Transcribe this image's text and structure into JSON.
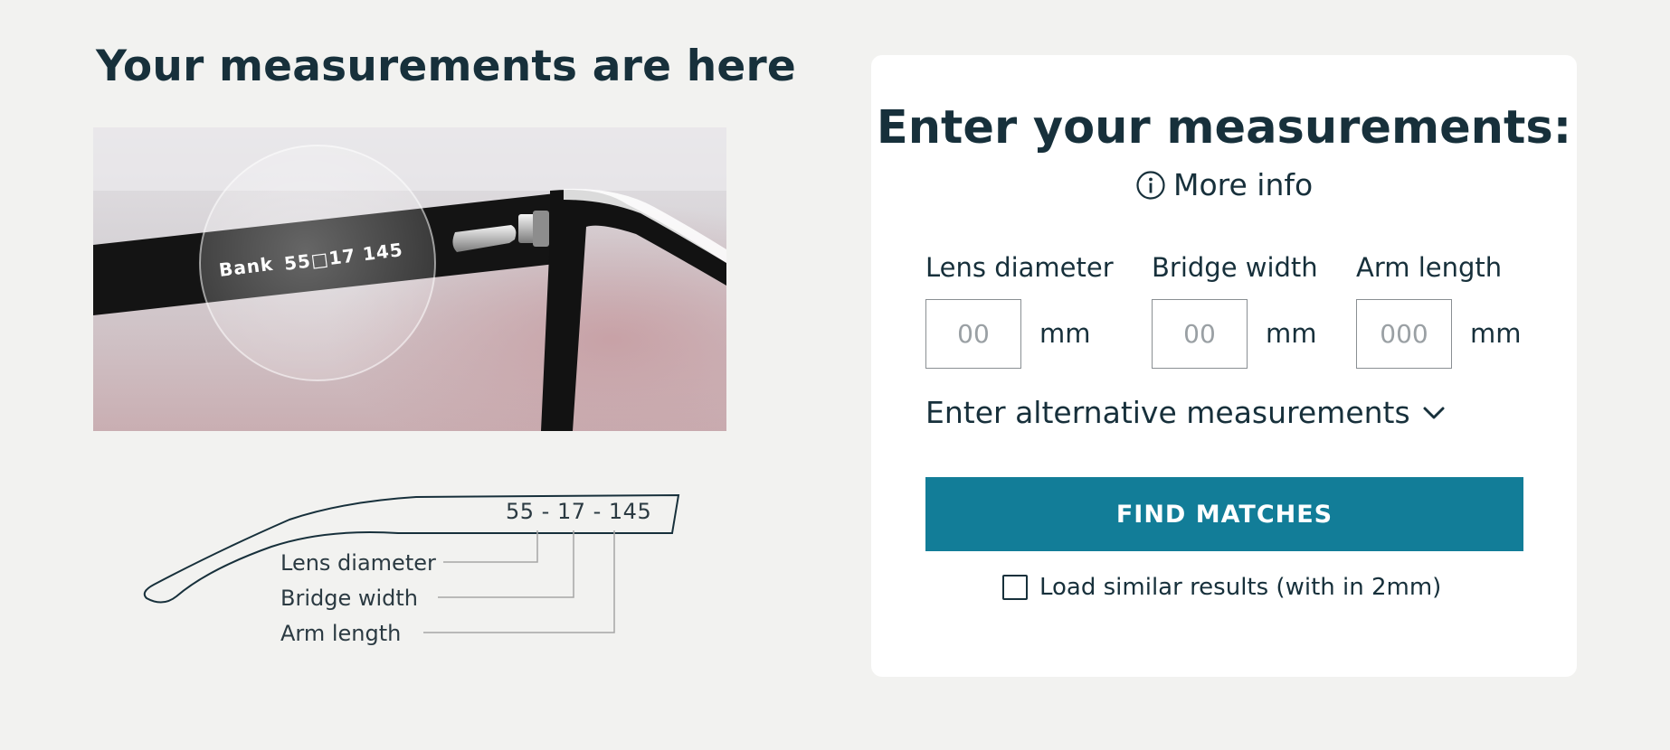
{
  "left": {
    "heading": "Your measurements are here",
    "photo": {
      "temple_print_brand": "Bank",
      "temple_print_code": "55□17 145"
    },
    "diagram": {
      "code": "55 - 17 - 145",
      "labels": {
        "lens": "Lens diameter",
        "bridge": "Bridge width",
        "arm": "Arm length"
      }
    }
  },
  "form": {
    "title": "Enter your measurements:",
    "more_info": "More info",
    "fields": {
      "lens": {
        "label": "Lens diameter",
        "placeholder": "00",
        "value": "",
        "unit": "mm"
      },
      "bridge": {
        "label": "Bridge width",
        "placeholder": "00",
        "value": "",
        "unit": "mm"
      },
      "arm": {
        "label": "Arm length",
        "placeholder": "000",
        "value": "",
        "unit": "mm"
      }
    },
    "alternative_toggle": "Enter alternative measurements",
    "submit_label": "FIND MATCHES",
    "similar_checkbox": {
      "label": "Load similar results (with in 2mm)",
      "checked": false
    }
  },
  "colors": {
    "background": "#f2f2f0",
    "text": "#17303b",
    "button": "#127d98",
    "card": "#ffffff"
  },
  "icons": {
    "more_info": "info-circle-icon",
    "alternative_toggle": "chevron-down-icon",
    "checkbox": "checkbox-empty-icon"
  }
}
